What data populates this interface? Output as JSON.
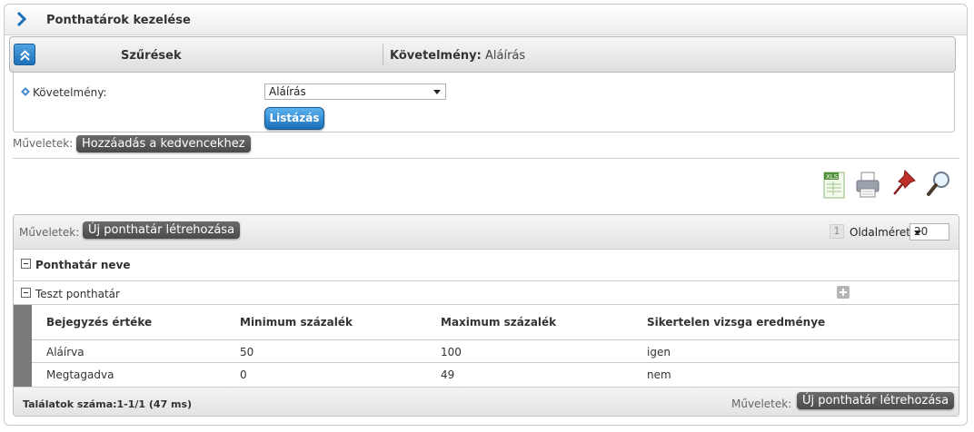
{
  "panel": {
    "title": "Ponthatárok kezelése"
  },
  "filter": {
    "title": "Szűrések",
    "summary_label": "Követelmény:",
    "summary_value": "Aláírás",
    "requirement_label": "Követelmény:",
    "requirement_value": "Aláírás",
    "list_button": "Listázás"
  },
  "ops_top": {
    "label": "Műveletek:",
    "favorite_button": "Hozzáadás a kedvencekhez"
  },
  "toolbar": {
    "icons": [
      "xls-export-icon",
      "print-icon",
      "pin-icon",
      "search-icon"
    ],
    "xls_text": "XLS"
  },
  "grid": {
    "ops_label": "Műveletek:",
    "new_button": "Új ponthatár létrehozása",
    "page_number": "1",
    "page_size_label": "Oldalméret",
    "page_size_value": "20",
    "group_column": "Ponthatár neve",
    "group_name": "Teszt ponthatár",
    "sub_columns": [
      "Bejegyzés értéke",
      "Minimum százalék",
      "Maximum százalék",
      "Sikertelen vizsga eredménye"
    ],
    "rows": [
      [
        "Aláírva",
        "50",
        "100",
        "igen"
      ],
      [
        "Megtagadva",
        "0",
        "49",
        "nem"
      ]
    ],
    "results": "Találatok száma:1-1/1 (47 ms)",
    "bottom_ops_label": "Műveletek:",
    "bottom_new_button": "Új ponthatár létrehozása"
  },
  "colors": {
    "accent_blue": "#1e6fb8",
    "dark_button": "#555555",
    "side_bar": "#7a7a7a"
  }
}
